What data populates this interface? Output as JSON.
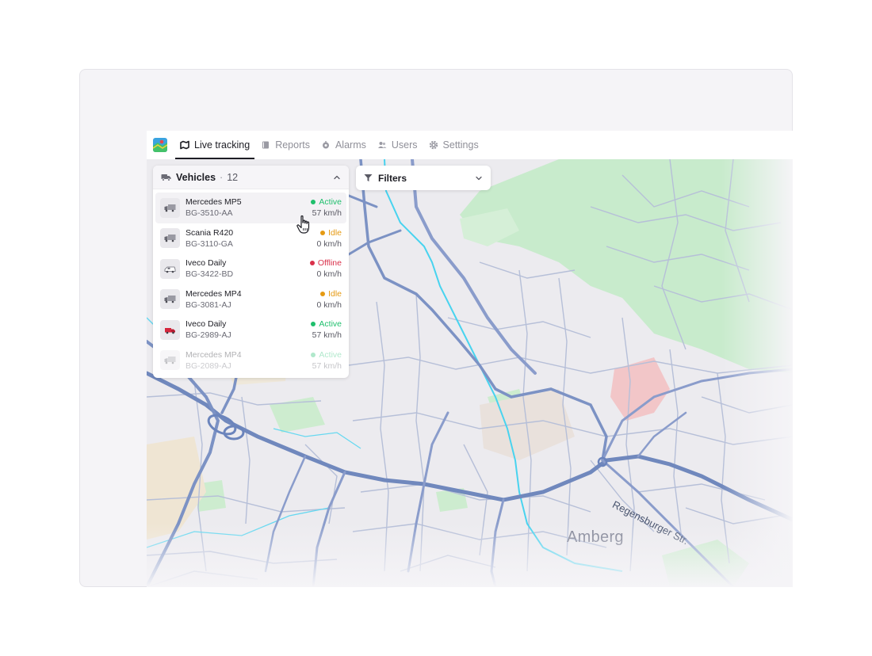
{
  "nav": {
    "tabs": [
      {
        "label": "Live tracking",
        "icon": "map-icon",
        "active": true
      },
      {
        "label": "Reports",
        "icon": "book-icon",
        "active": false
      },
      {
        "label": "Alarms",
        "icon": "alarm-icon",
        "active": false
      },
      {
        "label": "Users",
        "icon": "users-icon",
        "active": false
      },
      {
        "label": "Settings",
        "icon": "gear-icon",
        "active": false
      }
    ]
  },
  "vehicles_panel": {
    "title": "Vehicles",
    "separator": "·",
    "count": "12",
    "vehicles": [
      {
        "name": "Mercedes MP5",
        "plate": "BG-3510-AA",
        "status": "Active",
        "status_color": "#1fbf6c",
        "speed": "57 km/h",
        "thumb": "truck-icon"
      },
      {
        "name": "Scania R420",
        "plate": "BG-3110-GA",
        "status": "Idle",
        "status_color": "#e59a12",
        "speed": "0 km/h",
        "thumb": "truck-icon"
      },
      {
        "name": "Iveco Daily",
        "plate": "BG-3422-BD",
        "status": "Offline",
        "status_color": "#d9304a",
        "speed": "0 km/h",
        "thumb": "van-icon"
      },
      {
        "name": "Mercedes MP4",
        "plate": "BG-3081-AJ",
        "status": "Idle",
        "status_color": "#e59a12",
        "speed": "0 km/h",
        "thumb": "truck-icon"
      },
      {
        "name": "Iveco Daily",
        "plate": "BG-2989-AJ",
        "status": "Active",
        "status_color": "#1fbf6c",
        "speed": "57 km/h",
        "thumb": "red-van-icon"
      },
      {
        "name": "Mercedes MP4",
        "plate": "BG-2089-AJ",
        "status": "Active",
        "status_color": "#1fbf6c",
        "speed": "57 km/h",
        "thumb": "truck-icon"
      }
    ]
  },
  "filters": {
    "label": "Filters"
  },
  "map": {
    "city_label": "Amberg",
    "street_label": "Regensburger Str."
  },
  "colors": {
    "accent": "#1d1d24",
    "road_major": "#6f86b8",
    "road_minor": "#a4b1cf",
    "river": "#3fd0ee",
    "park": "#bfe8c4",
    "built": "#e6e1e4"
  }
}
